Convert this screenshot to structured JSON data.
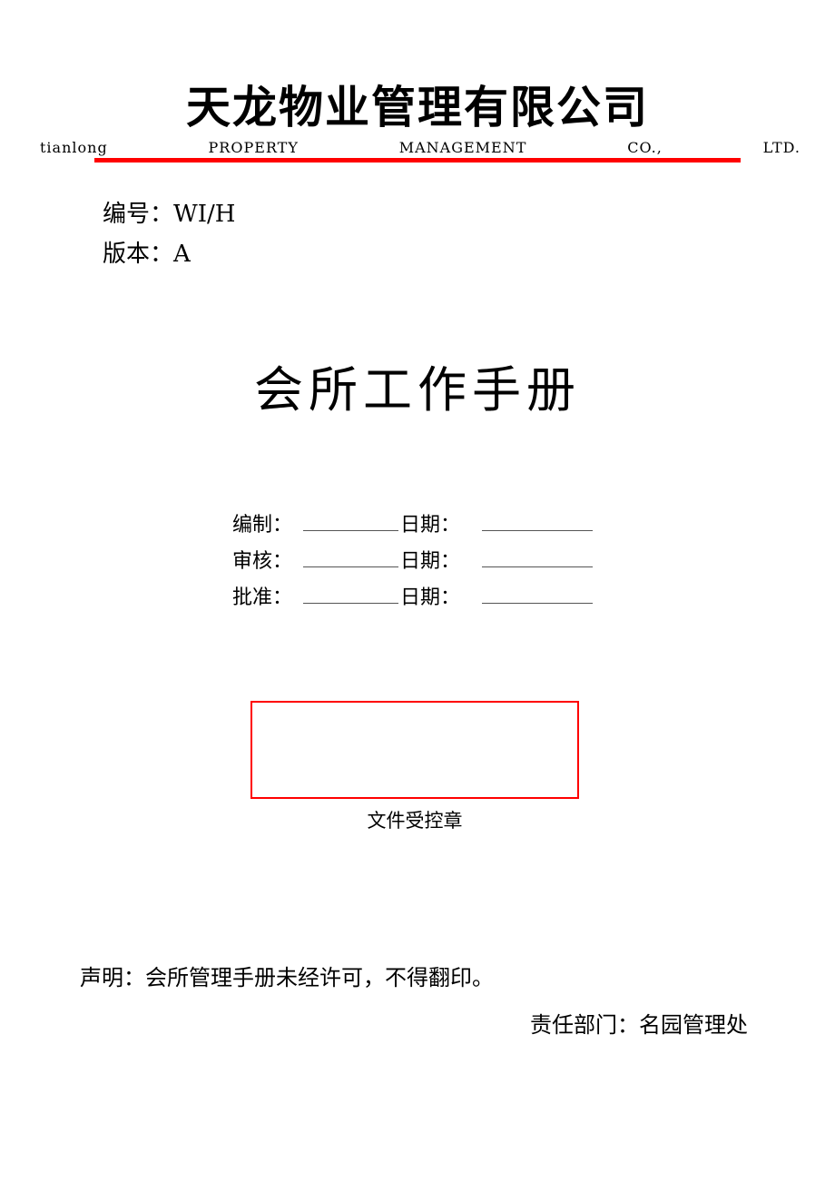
{
  "letterhead": {
    "company_name_cn": "天龙物业管理有限公司",
    "company_name_en_words": [
      "tianlong",
      "PROPERTY",
      "MANAGEMENT",
      "CO.,",
      "LTD."
    ],
    "rule_color": "#ff0000"
  },
  "doc_meta": {
    "code_label": "编号：",
    "code_value": "WI/H",
    "version_label": "版本：",
    "version_value": "A"
  },
  "title": {
    "text": "会所工作手册"
  },
  "signatures": {
    "date_label": "日期：",
    "rows": [
      {
        "label": "编制：",
        "value": "",
        "date_value": ""
      },
      {
        "label": "审核：",
        "value": "",
        "date_value": ""
      },
      {
        "label": "批准：",
        "value": "",
        "date_value": ""
      }
    ]
  },
  "stamp": {
    "caption": "文件受控章",
    "border_color": "#ff0000",
    "content": ""
  },
  "footer": {
    "statement": "声明：会所管理手册未经许可，不得翻印。",
    "department": "责任部门：名园管理处"
  }
}
